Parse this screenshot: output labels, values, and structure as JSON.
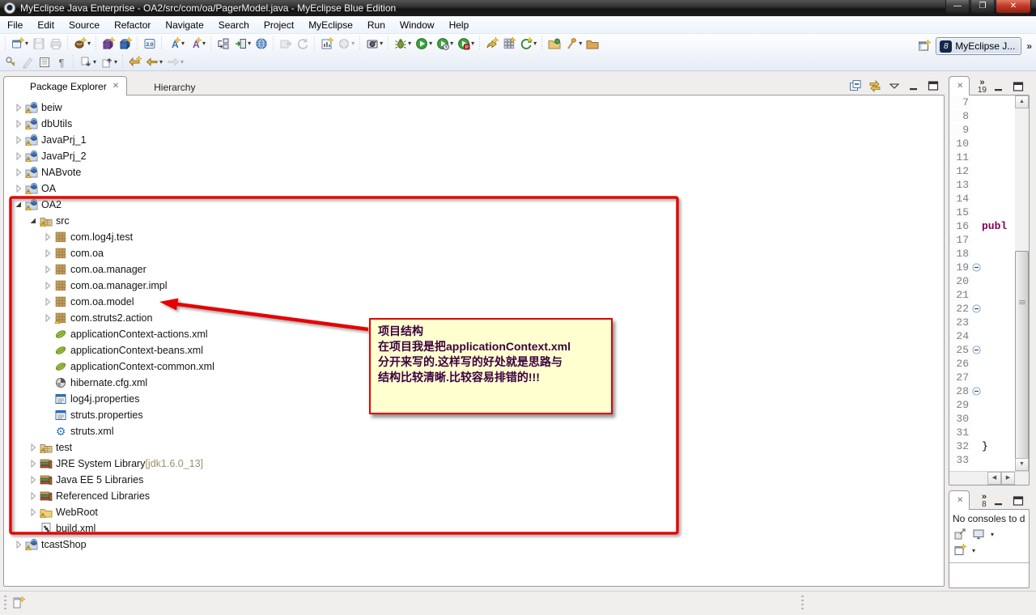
{
  "window": {
    "title": "MyEclipse Java Enterprise - OA2/src/com/oa/PagerModel.java - MyEclipse Blue Edition",
    "controls": [
      {
        "name": "minimize",
        "glyph": "—"
      },
      {
        "name": "restore",
        "glyph": "❐"
      },
      {
        "name": "close",
        "glyph": "✕"
      }
    ]
  },
  "menu_bar": [
    "File",
    "Edit",
    "Source",
    "Refactor",
    "Navigate",
    "Search",
    "Project",
    "MyEclipse",
    "Run",
    "Window",
    "Help"
  ],
  "toolbar": {
    "row1_groups": [
      [
        {
          "n": "new-wizard",
          "dd": true
        },
        {
          "n": "save",
          "dis": true
        },
        {
          "n": "print",
          "dis": true
        }
      ],
      [
        {
          "n": "new-java-bean",
          "dd": true
        }
      ],
      [
        {
          "n": "new-ejb-project"
        },
        {
          "n": "new-web-project"
        }
      ],
      [
        {
          "n": "jpa-2-0"
        }
      ],
      [
        {
          "n": "new-class",
          "dd": true
        },
        {
          "n": "new-interface",
          "dd": true
        }
      ],
      [
        {
          "n": "deploy-sync"
        },
        {
          "n": "deploy",
          "dd": true
        },
        {
          "n": "web-browser"
        }
      ],
      [
        {
          "n": "export-war",
          "dis": true
        },
        {
          "n": "refresh-redo",
          "dis": true
        }
      ],
      [
        {
          "n": "new-report"
        },
        {
          "n": "web-service",
          "dd": true,
          "dis": true
        }
      ],
      [
        {
          "n": "screen-capture",
          "dd": true
        }
      ],
      [
        {
          "n": "debug",
          "dd": true
        },
        {
          "n": "run",
          "dd": true
        },
        {
          "n": "run-external",
          "dd": true
        },
        {
          "n": "profile",
          "dd": true
        }
      ],
      [
        {
          "n": "new-web-component"
        },
        {
          "n": "new-xml-grid"
        },
        {
          "n": "refresh-g",
          "dd": true
        }
      ],
      [
        {
          "n": "open-resource"
        },
        {
          "n": "search-torch",
          "dd": true
        },
        {
          "n": "open-directory"
        }
      ]
    ],
    "row2_groups": [
      [
        {
          "n": "externalize-strings"
        },
        {
          "n": "mark-occurrences",
          "dis": true
        },
        {
          "n": "show-source"
        },
        {
          "n": "show-whitespace"
        }
      ],
      [
        {
          "n": "next-annotation",
          "dd": true
        },
        {
          "n": "prev-annotation",
          "dd": true
        }
      ],
      [
        {
          "n": "last-edit-location"
        },
        {
          "n": "back",
          "dd": true
        },
        {
          "n": "forward",
          "dd": true,
          "dis": true
        }
      ]
    ],
    "perspective": {
      "open_icon": "open-perspective",
      "button_label": "MyEclipse J...",
      "overflow": "»"
    }
  },
  "package_explorer": {
    "tabs": [
      {
        "label": "Package Explorer",
        "icon": "package-explorer-icon",
        "active": true,
        "closable": true
      },
      {
        "label": "Hierarchy",
        "icon": "hierarchy-icon",
        "active": false,
        "closable": false
      }
    ],
    "view_toolbar": [
      {
        "name": "collapse-all"
      },
      {
        "name": "link-with-editor"
      },
      {
        "name": "view-menu"
      },
      {
        "name": "minimize-view"
      },
      {
        "name": "maximize-view"
      }
    ],
    "tree": [
      {
        "label": "beiw",
        "icon": "java-project",
        "depth": 0,
        "state": "collapsed"
      },
      {
        "label": "dbUtils",
        "icon": "java-project",
        "depth": 0,
        "state": "collapsed"
      },
      {
        "label": "JavaPrj_1",
        "icon": "java-project",
        "depth": 0,
        "state": "collapsed"
      },
      {
        "label": "JavaPrj_2",
        "icon": "java-project",
        "depth": 0,
        "state": "collapsed"
      },
      {
        "label": "NABvote",
        "icon": "java-project",
        "depth": 0,
        "state": "collapsed"
      },
      {
        "label": "OA",
        "icon": "java-project",
        "depth": 0,
        "state": "collapsed"
      },
      {
        "label": "OA2",
        "icon": "java-project",
        "depth": 0,
        "state": "expanded"
      },
      {
        "label": "src",
        "icon": "src-folder",
        "depth": 1,
        "state": "expanded"
      },
      {
        "label": "com.log4j.test",
        "icon": "package",
        "depth": 2,
        "state": "collapsed"
      },
      {
        "label": "com.oa",
        "icon": "package",
        "depth": 2,
        "state": "collapsed"
      },
      {
        "label": "com.oa.manager",
        "icon": "package",
        "depth": 2,
        "state": "collapsed"
      },
      {
        "label": "com.oa.manager.impl",
        "icon": "package",
        "depth": 2,
        "state": "collapsed"
      },
      {
        "label": "com.oa.model",
        "icon": "package",
        "depth": 2,
        "state": "collapsed"
      },
      {
        "label": "com.struts2.action",
        "icon": "package-warning",
        "depth": 2,
        "state": "collapsed"
      },
      {
        "label": "applicationContext-actions.xml",
        "icon": "spring-leaf",
        "depth": 2,
        "state": "leaf"
      },
      {
        "label": "applicationContext-beans.xml",
        "icon": "spring-leaf",
        "depth": 2,
        "state": "leaf"
      },
      {
        "label": "applicationContext-common.xml",
        "icon": "spring-leaf",
        "depth": 2,
        "state": "leaf"
      },
      {
        "label": "hibernate.cfg.xml",
        "icon": "hibernate-file",
        "depth": 2,
        "state": "leaf"
      },
      {
        "label": "log4j.properties",
        "icon": "properties-file",
        "depth": 2,
        "state": "leaf"
      },
      {
        "label": "struts.properties",
        "icon": "properties-file",
        "depth": 2,
        "state": "leaf"
      },
      {
        "label": "struts.xml",
        "icon": "struts-gear",
        "depth": 2,
        "state": "leaf"
      },
      {
        "label": "test",
        "icon": "src-folder",
        "depth": 1,
        "state": "collapsed"
      },
      {
        "label": "JRE System Library",
        "suffix": " [jdk1.6.0_13]",
        "icon": "library",
        "depth": 1,
        "state": "collapsed"
      },
      {
        "label": "Java EE 5 Libraries",
        "icon": "library",
        "depth": 1,
        "state": "collapsed"
      },
      {
        "label": "Referenced Libraries",
        "icon": "library",
        "depth": 1,
        "state": "collapsed"
      },
      {
        "label": "WebRoot",
        "icon": "folder-warning",
        "depth": 1,
        "state": "collapsed"
      },
      {
        "label": "build.xml",
        "icon": "ant-file",
        "depth": 1,
        "state": "leaf"
      },
      {
        "label": "tcastShop",
        "icon": "java-project",
        "depth": 0,
        "state": "collapsed"
      }
    ]
  },
  "annotation": {
    "lines": [
      "项目结构",
      "在项目我是把applicationContext.xml",
      "分开来写的.这样写的好处就是思路与",
      "结构比较清晰.比较容易排错的!!!"
    ]
  },
  "editor_strip": {
    "overflow_chevron": "»",
    "overflow_count": "19",
    "first_line": 7,
    "last_line": 33,
    "code_by_line": {
      "16": "publ",
      "32": "}"
    },
    "keyword_lines": [
      16
    ],
    "fold_lines": [
      19,
      22,
      25,
      28
    ]
  },
  "console_panel": {
    "overflow_chevron": "»",
    "overflow_count": "8",
    "message": "No consoles to d",
    "toolbar_row1": [
      {
        "name": "pin-console"
      },
      {
        "name": "display-selected-console",
        "dd": true
      }
    ],
    "toolbar_row2": [
      {
        "name": "open-console",
        "dd": true
      }
    ]
  },
  "colors": {
    "annotation_red": "#e60000",
    "callout_bg": "#ffffcf",
    "callout_text": "#3a0040",
    "keyword": "#7f0055",
    "line_number": "#7f7f7f",
    "library_suffix": "#9c9069",
    "titlebar_text": "#f2f2f2"
  }
}
